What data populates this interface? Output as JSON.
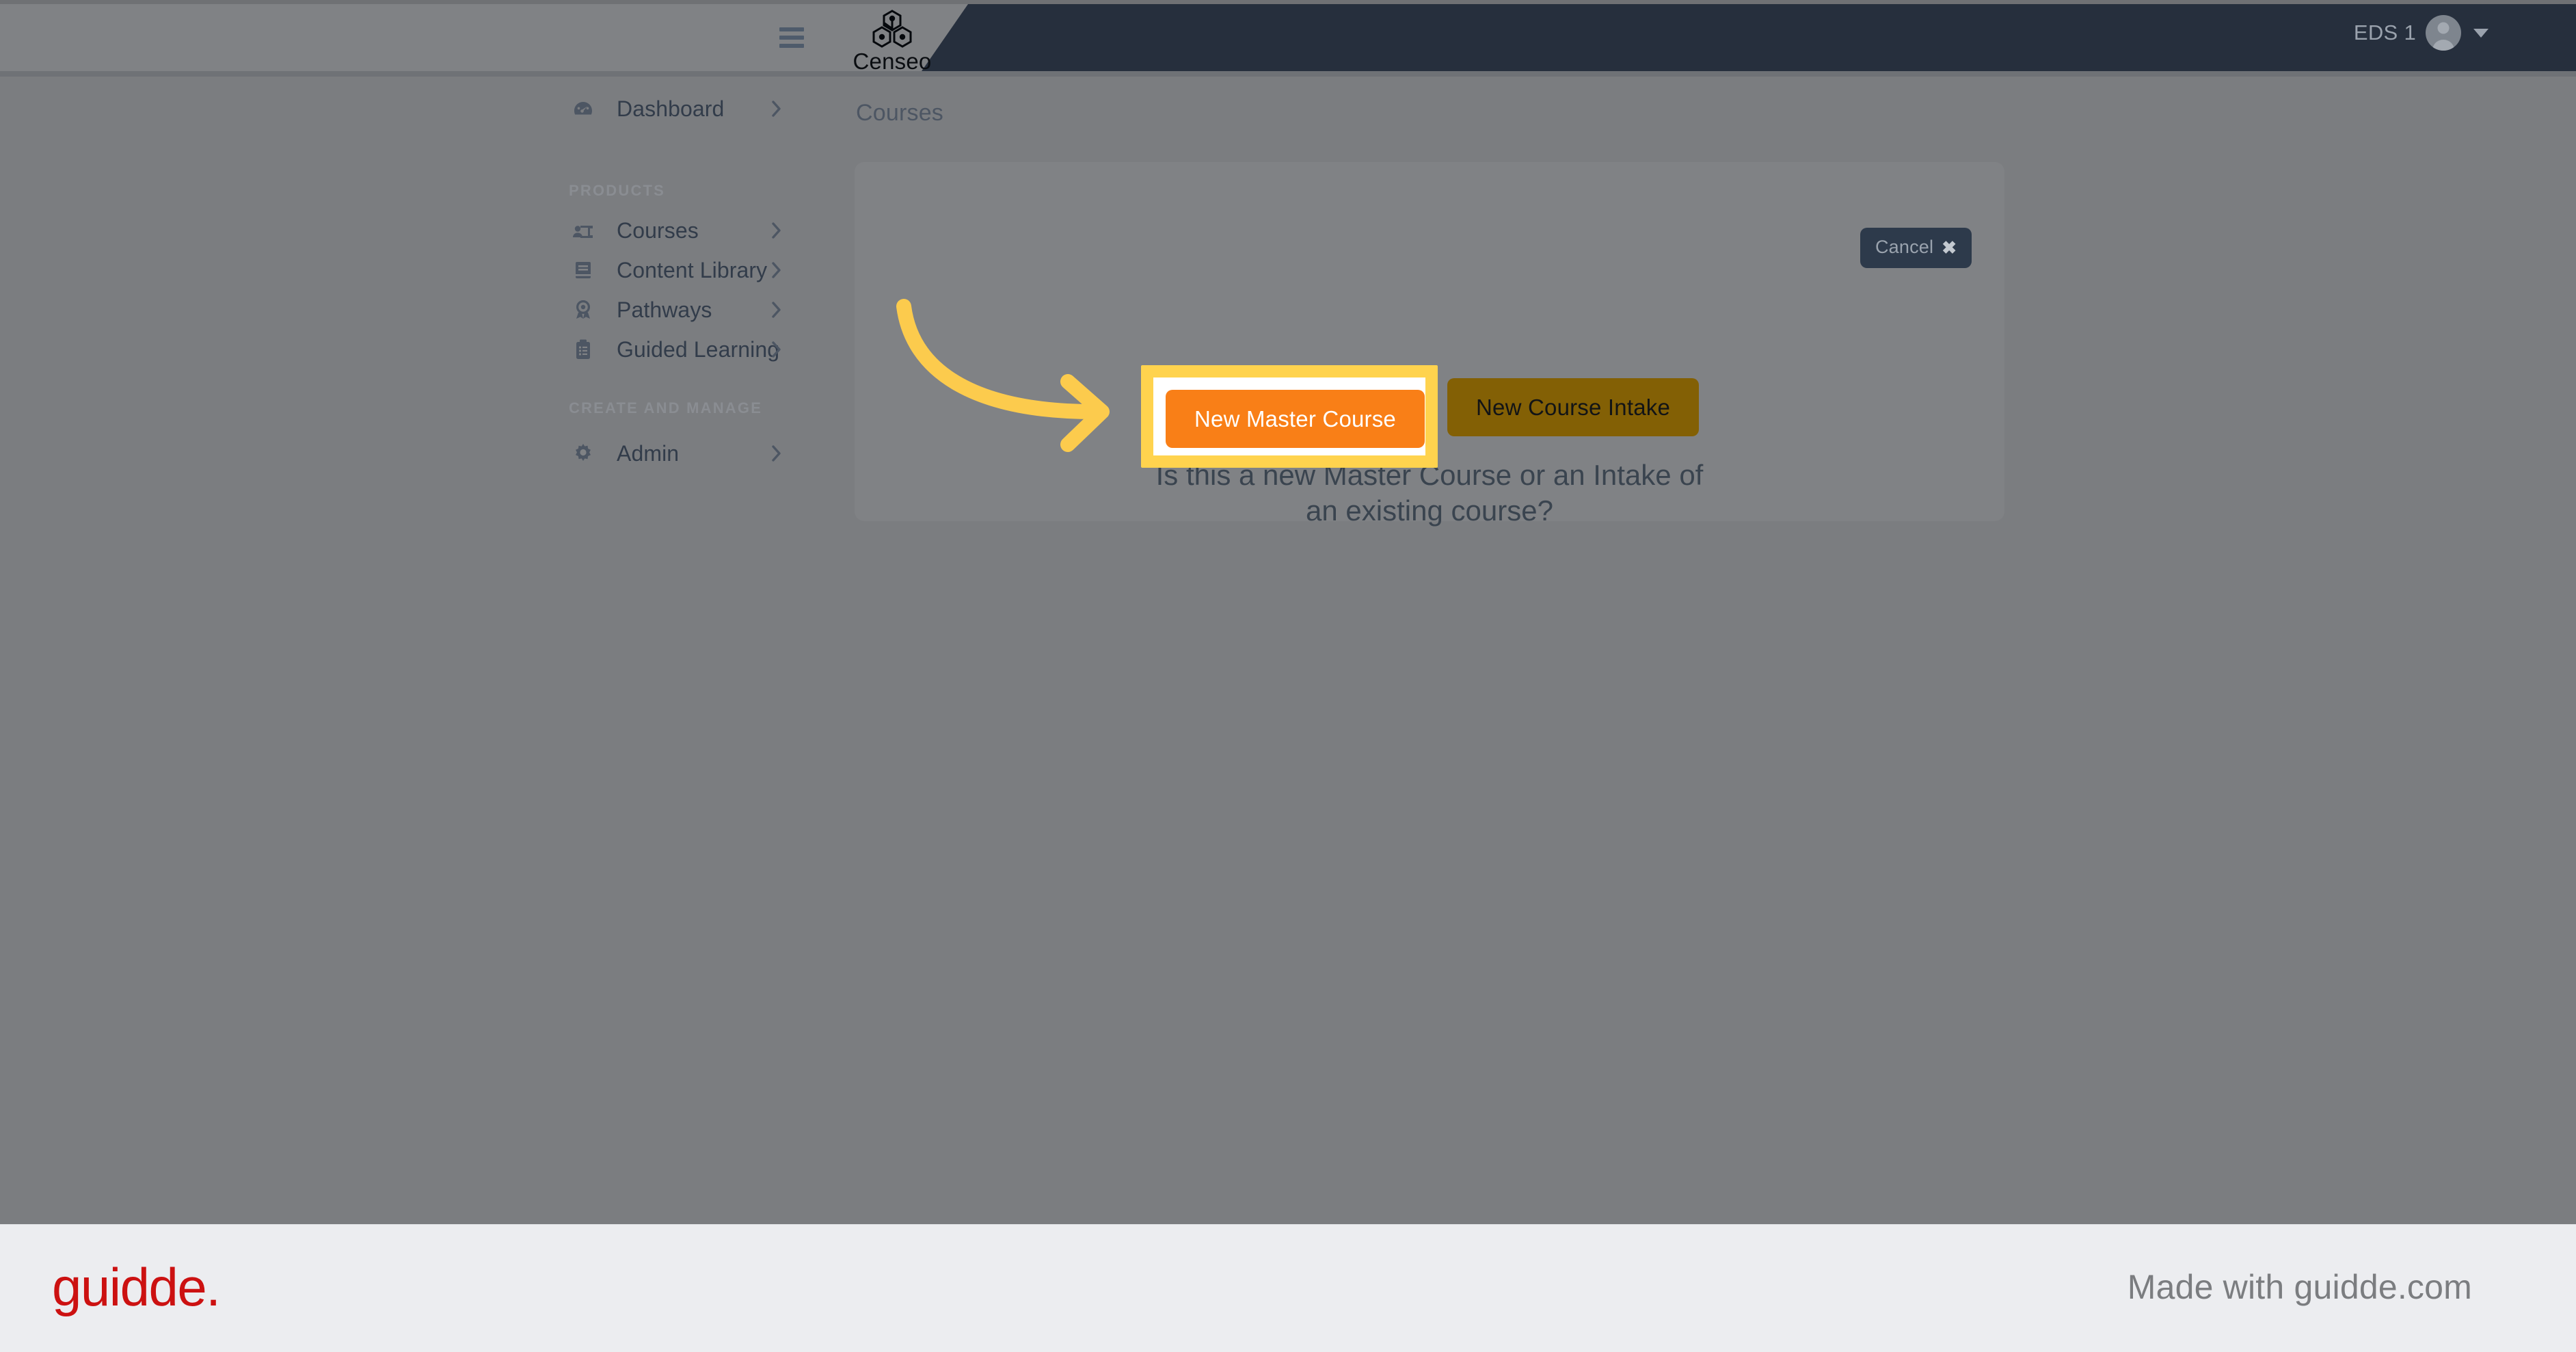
{
  "header": {
    "menu_icon": "hamburger-menu-icon",
    "brand_name": "Censeo",
    "brand_mark": "hexagon-network-logo",
    "user_name": "EDS 1",
    "avatar_icon": "user-avatar-icon",
    "caret_icon": "caret-down-icon"
  },
  "sidebar": {
    "top_items": [
      {
        "label": "Dashboard",
        "icon": "speedometer-icon",
        "chevron": "chevron-right-icon"
      }
    ],
    "sections": [
      {
        "title": "PRODUCTS",
        "items": [
          {
            "label": "Courses",
            "icon": "presentation-user-icon",
            "chevron": "chevron-right-icon"
          },
          {
            "label": "Content Library",
            "icon": "book-icon",
            "chevron": "chevron-right-icon"
          },
          {
            "label": "Pathways",
            "icon": "award-ribbon-icon",
            "chevron": "chevron-right-icon"
          },
          {
            "label": "Guided Learning",
            "icon": "clipboard-list-icon",
            "chevron": "chevron-right-icon"
          }
        ]
      },
      {
        "title": "CREATE AND MANAGE",
        "items": [
          {
            "label": "Admin",
            "icon": "gear-icon",
            "chevron": "chevron-right-icon"
          }
        ]
      }
    ]
  },
  "main": {
    "page_title": "Courses",
    "cancel_label": "Cancel",
    "cancel_icon": "close-x-icon",
    "prompt": "Is this a new Master Course or an Intake of an existing course?",
    "primary_button": "New Master Course",
    "secondary_button": "New Course Intake"
  },
  "annotation": {
    "arrow_icon": "curved-arrow-right-icon",
    "highlight_color": "#ffd34e",
    "arrow_color": "#fccb4d"
  },
  "footer": {
    "logo_text": "guidde.",
    "made_with": "Made with guidde.com",
    "logo_color": "#cc1111"
  },
  "colors": {
    "overlay": "#7b7d80",
    "header_dark": "#262f3d",
    "primary_orange": "#f97f17",
    "secondary_olive": "#836005",
    "footer_bg": "#ecedf0"
  }
}
